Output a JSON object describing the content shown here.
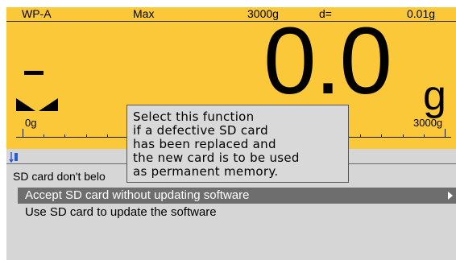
{
  "status_bar": {
    "weigh_point": "WP-A",
    "max_label": "Max",
    "max_value": "3000g",
    "d_label": "d=",
    "d_value": "0.01g"
  },
  "display": {
    "reading": "0.0",
    "unit": "g"
  },
  "scale": {
    "min_label": "0g",
    "max_label": "3000g",
    "fill_fraction": 0.0
  },
  "menu": {
    "icon": "balance-setup-icon",
    "heading": "SD card don't belo",
    "items": [
      {
        "label": "Accept SD card without updating software",
        "selected": true
      },
      {
        "label": "Use SD card to update the software",
        "selected": false
      }
    ]
  },
  "tooltip": {
    "lines": [
      "Select this function",
      "if a defective SD card",
      "has been replaced and",
      "the new card is to be used",
      "as permanent memory."
    ]
  },
  "colors": {
    "panel": "#fbc83a",
    "menu_bg": "#d6d6d6",
    "selection": "#6e6e6e",
    "tooltip_bg": "#d9d9d9"
  }
}
